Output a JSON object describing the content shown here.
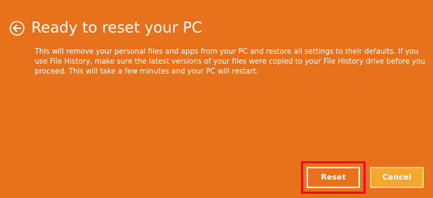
{
  "dialog": {
    "title": "Ready to reset your PC",
    "description": "This will remove your personal files and apps from your PC and restore all settings to their defaults. If you use File History, make sure the latest versions of your files were copied to your File History drive before you proceed. This will take a few minutes and your PC will restart.",
    "back_icon": "back-arrow-circle-icon",
    "buttons": {
      "reset_label": "Reset",
      "cancel_label": "Cancel"
    }
  },
  "colors": {
    "background": "#e8711c",
    "text": "#ffffff",
    "highlight_box": "#e2141c",
    "cancel_button": "#f5a82e"
  }
}
